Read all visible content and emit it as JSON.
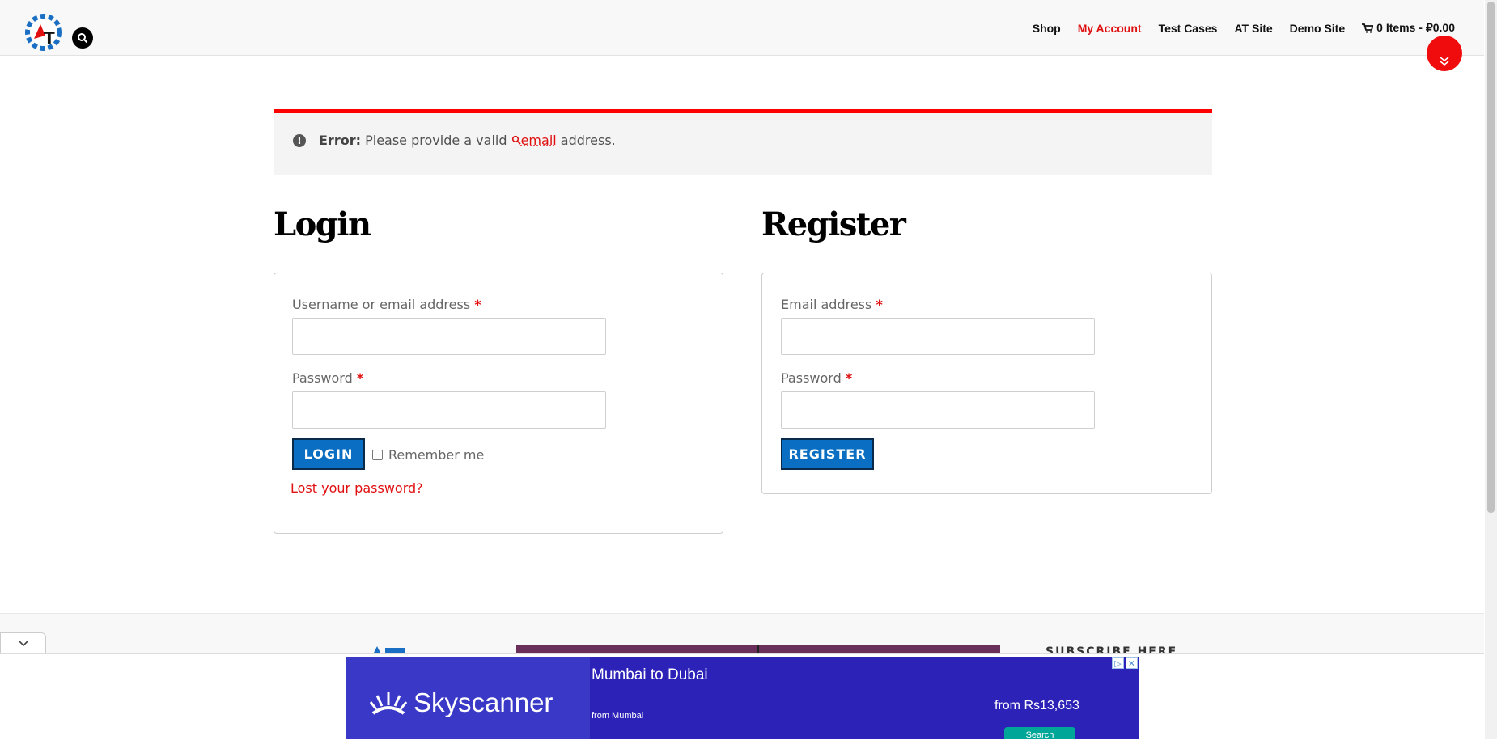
{
  "header": {
    "logo_letter": "T",
    "nav": [
      {
        "label": "Shop",
        "active": false
      },
      {
        "label": "My Account",
        "active": true
      },
      {
        "label": "Test Cases",
        "active": false
      },
      {
        "label": "AT Site",
        "active": false
      },
      {
        "label": "Demo Site",
        "active": false
      }
    ],
    "cart_label": "0 Items - ₽0.00"
  },
  "error": {
    "prefix": "Error:",
    "message_before": "Please provide a valid",
    "link": "email",
    "message_after": "address."
  },
  "login": {
    "title": "Login",
    "username_label": "Username or email address",
    "password_label": "Password",
    "required_mark": "*",
    "username_value": "",
    "password_value": "",
    "submit_label": "LOGIN",
    "remember_label": "Remember me",
    "remember_checked": false,
    "lost_password": "Lost your password?"
  },
  "register": {
    "title": "Register",
    "email_label": "Email address",
    "password_label": "Password",
    "required_mark": "*",
    "email_value": "",
    "password_value": "",
    "submit_label": "REGISTER"
  },
  "footer": {
    "subscribe_heading": "SUBSCRIBE HERE"
  },
  "ad": {
    "brand": "Skyscanner",
    "route": "Mumbai to Dubai",
    "from": "from Mumbai",
    "price": "from Rs13,653",
    "cta": "Search"
  },
  "colors": {
    "accent_red": "#ff0000",
    "button_blue": "#0a6fc2",
    "ad_blue": "#2d22b8"
  }
}
